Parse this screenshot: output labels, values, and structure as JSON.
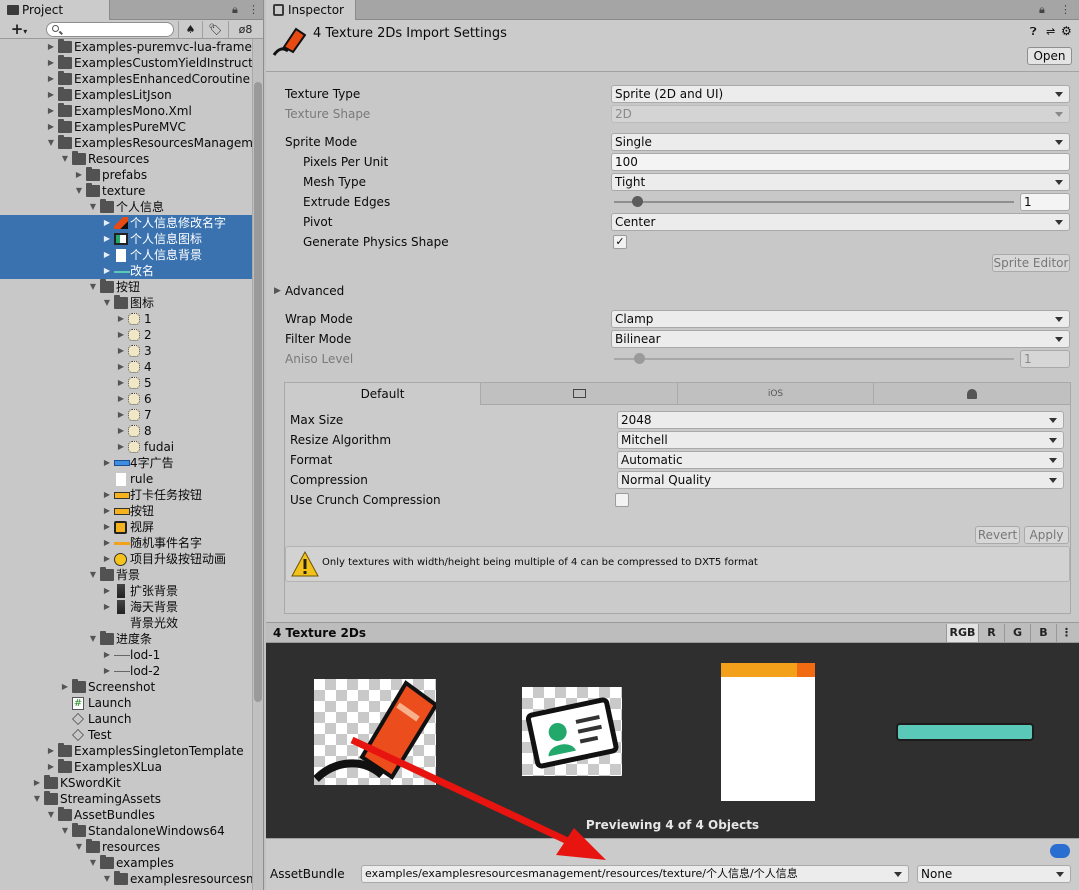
{
  "project_panel": {
    "tab": "Project",
    "toolbar": {
      "add": "+",
      "hidden_count": "8"
    },
    "tree": [
      {
        "label": "Examples-puremvc-lua-framewo",
        "type": "folder",
        "collapsed": true
      },
      {
        "label": "ExamplesCustomYieldInstruction",
        "type": "folder",
        "collapsed": true
      },
      {
        "label": "ExamplesEnhancedCoroutine",
        "type": "folder",
        "collapsed": true
      },
      {
        "label": "ExamplesLitJson",
        "type": "folder",
        "collapsed": true
      },
      {
        "label": "ExamplesMono.Xml",
        "type": "folder",
        "collapsed": true
      },
      {
        "label": "ExamplesPureMVC",
        "type": "folder",
        "collapsed": true
      },
      {
        "label": "ExamplesResourcesManagement",
        "type": "folder",
        "expanded": true
      },
      {
        "label": "Resources",
        "type": "folder",
        "expanded": true
      },
      {
        "label": "prefabs",
        "type": "folder",
        "collapsed": true
      },
      {
        "label": "texture",
        "type": "folder",
        "expanded": true
      },
      {
        "label": "个人信息",
        "type": "folder",
        "expanded": true
      },
      {
        "label": "个人信息修改名字",
        "type": "sprite-pen",
        "selected": true
      },
      {
        "label": "个人信息图标",
        "type": "sprite-card",
        "selected": true
      },
      {
        "label": "个人信息背景",
        "type": "sprite-white",
        "selected": true
      },
      {
        "label": "改名",
        "type": "sprite-line",
        "selected": true
      },
      {
        "label": "按钮",
        "type": "folder",
        "expanded": true
      },
      {
        "label": "图标",
        "type": "folder",
        "expanded": true
      },
      {
        "label": "1",
        "type": "sprite-icon"
      },
      {
        "label": "2",
        "type": "sprite-icon"
      },
      {
        "label": "3",
        "type": "sprite-icon"
      },
      {
        "label": "4",
        "type": "sprite-icon"
      },
      {
        "label": "5",
        "type": "sprite-icon"
      },
      {
        "label": "6",
        "type": "sprite-icon"
      },
      {
        "label": "7",
        "type": "sprite-icon"
      },
      {
        "label": "8",
        "type": "sprite-icon"
      },
      {
        "label": "fudai",
        "type": "sprite-icon"
      },
      {
        "label": "4字广告",
        "type": "sprite-bar"
      },
      {
        "label": "rule",
        "type": "sprite-white"
      },
      {
        "label": "打卡任务按钮",
        "type": "sprite-orange"
      },
      {
        "label": "按钮",
        "type": "sprite-orange"
      },
      {
        "label": "视屏",
        "type": "sprite-play"
      },
      {
        "label": "随机事件名字",
        "type": "sprite-line-orange"
      },
      {
        "label": "项目升级按钮动画",
        "type": "sprite-circle"
      },
      {
        "label": "背景",
        "type": "folder",
        "expanded": true
      },
      {
        "label": "扩张背景",
        "type": "sprite-dark"
      },
      {
        "label": "海天背景",
        "type": "sprite-dark"
      },
      {
        "label": "背景光效",
        "type": "sprite-none"
      },
      {
        "label": "进度条",
        "type": "folder",
        "expanded": true
      },
      {
        "label": "lod-1",
        "type": "sprite-line-gray"
      },
      {
        "label": "lod-2",
        "type": "sprite-line-gray"
      },
      {
        "label": "Screenshot",
        "type": "folder",
        "collapsed": true
      },
      {
        "label": "Launch",
        "type": "script"
      },
      {
        "label": "Launch",
        "type": "scene"
      },
      {
        "label": "Test",
        "type": "scene"
      },
      {
        "label": "ExamplesSingletonTemplate",
        "type": "folder",
        "collapsed": true
      },
      {
        "label": "ExamplesXLua",
        "type": "folder",
        "collapsed": true
      },
      {
        "label": "KSwordKit",
        "type": "folder",
        "collapsed": true
      },
      {
        "label": "StreamingAssets",
        "type": "folder",
        "expanded": true
      },
      {
        "label": "AssetBundles",
        "type": "folder",
        "expanded": true
      },
      {
        "label": "StandaloneWindows64",
        "type": "folder",
        "expanded": true
      },
      {
        "label": "resources",
        "type": "folder",
        "expanded": true
      },
      {
        "label": "examples",
        "type": "folder",
        "expanded": true
      },
      {
        "label": "examplesresourcesman",
        "type": "folder",
        "expanded": true
      }
    ]
  },
  "inspector": {
    "tab": "Inspector",
    "title": "4 Texture 2Ds Import Settings",
    "open_button": "Open",
    "properties": {
      "texture_type": {
        "label": "Texture Type",
        "value": "Sprite (2D and UI)"
      },
      "texture_shape": {
        "label": "Texture Shape",
        "value": "2D"
      },
      "sprite_mode": {
        "label": "Sprite Mode",
        "value": "Single"
      },
      "pixels_per_unit": {
        "label": "Pixels Per Unit",
        "value": "100"
      },
      "mesh_type": {
        "label": "Mesh Type",
        "value": "Tight"
      },
      "extrude_edges": {
        "label": "Extrude Edges",
        "value": "1",
        "slider_fraction": 0.03
      },
      "pivot": {
        "label": "Pivot",
        "value": "Center"
      },
      "generate_physics_shape": {
        "label": "Generate Physics Shape",
        "checked": true,
        "check": "✓"
      },
      "sprite_editor": "Sprite Editor",
      "advanced": "Advanced",
      "wrap_mode": {
        "label": "Wrap Mode",
        "value": "Clamp"
      },
      "filter_mode": {
        "label": "Filter Mode",
        "value": "Bilinear"
      },
      "aniso_level": {
        "label": "Aniso Level",
        "value": "1",
        "slider_fraction": 0.0
      }
    },
    "platform_tabs": [
      "Default",
      "",
      "iOS",
      ""
    ],
    "platform": {
      "max_size": {
        "label": "Max Size",
        "value": "2048"
      },
      "resize_algorithm": {
        "label": "Resize Algorithm",
        "value": "Mitchell"
      },
      "format": {
        "label": "Format",
        "value": "Automatic"
      },
      "compression": {
        "label": "Compression",
        "value": "Normal Quality"
      },
      "use_crunch": {
        "label": "Use Crunch Compression",
        "checked": false
      }
    },
    "revert": "Revert",
    "apply": "Apply",
    "warning": "Only textures with width/height being multiple of 4 can be compressed to DXT5 format",
    "preview": {
      "title": "4 Texture 2Ds",
      "channels": [
        "RGB",
        "R",
        "G",
        "B"
      ],
      "status": "Previewing 4 of 4 Objects"
    },
    "assetbundle": {
      "label": "AssetBundle",
      "value": "examples/examplesresourcesmanagement/resources/texture/个人信息/个人信息",
      "variant": "None"
    }
  },
  "colors": {
    "selection": "#3a72b0",
    "panel": "#c8c8c8",
    "preview_bg": "#2f2f2f",
    "arrow": "#e8140f"
  }
}
